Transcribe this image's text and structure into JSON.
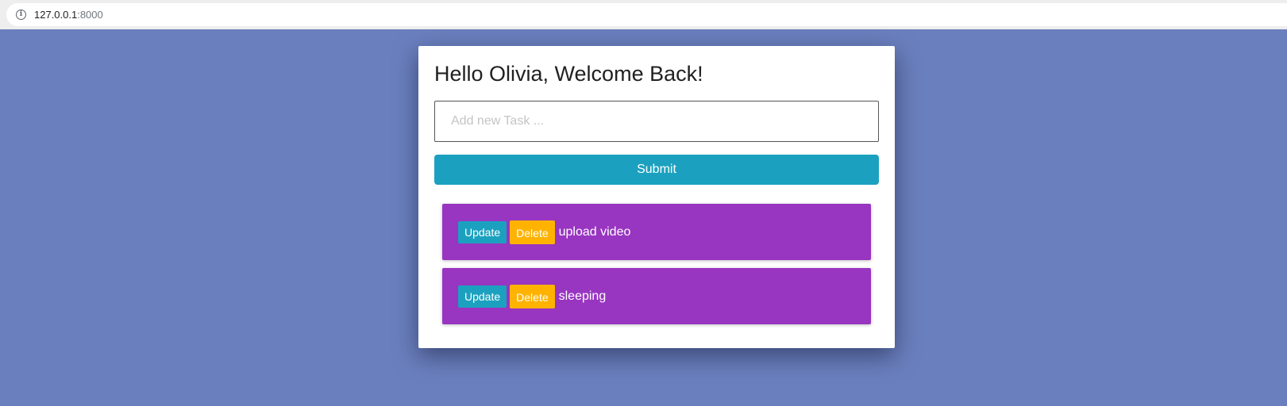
{
  "browser": {
    "url_host": "127.0.0.1",
    "url_port": ":8000"
  },
  "card": {
    "title": "Hello Olivia, Welcome Back!",
    "input_placeholder": "Add new Task ...",
    "input_value": "",
    "submit_label": "Submit"
  },
  "tasks": [
    {
      "update_label": "Update",
      "delete_label": "Delete",
      "text": "upload video"
    },
    {
      "update_label": "Update",
      "delete_label": "Delete",
      "text": "sleeping"
    }
  ],
  "colors": {
    "background": "#6a7fbd",
    "submit": "#1ba1bf",
    "task_item": "#9835c1",
    "delete": "#ffb300"
  },
  "icons": [
    "info-icon"
  ]
}
